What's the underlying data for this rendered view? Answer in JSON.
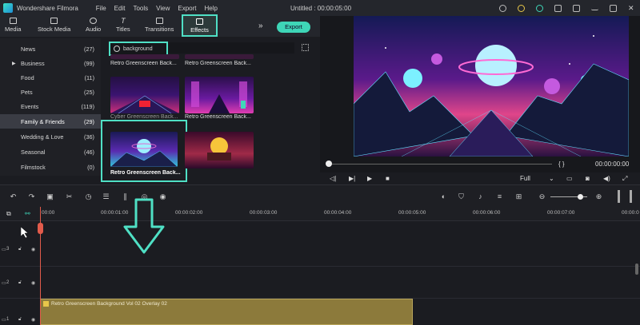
{
  "app": {
    "name": "Wondershare Filmora",
    "menu": [
      "File",
      "Edit",
      "Tools",
      "View",
      "Export",
      "Help"
    ],
    "window_title": "Untitled : 00:00:05:00"
  },
  "toolbar": {
    "tabs": [
      "Media",
      "Stock Media",
      "Audio",
      "Titles",
      "Transitions",
      "Effects"
    ],
    "export_label": "Export",
    "more": "»"
  },
  "categories": [
    {
      "name": "News",
      "count": "(27)"
    },
    {
      "name": "Business",
      "count": "(99)"
    },
    {
      "name": "Food",
      "count": "(11)"
    },
    {
      "name": "Pets",
      "count": "(25)"
    },
    {
      "name": "Events",
      "count": "(119)"
    },
    {
      "name": "Family & Friends",
      "count": "(29)"
    },
    {
      "name": "Wedding & Love",
      "count": "(36)"
    },
    {
      "name": "Seasonal",
      "count": "(46)"
    },
    {
      "name": "Filmstock",
      "count": "(0)"
    }
  ],
  "search": {
    "value": "background"
  },
  "effects": [
    {
      "caption": "Retro Greenscreen Back..."
    },
    {
      "caption": "Retro Greenscreen Back..."
    },
    {
      "caption": "Cyber Greenscreen Back..."
    },
    {
      "caption": "Retro Greenscreen Back..."
    },
    {
      "caption": "Retro Greenscreen Back..."
    }
  ],
  "player": {
    "timecode": "00:00:00:00",
    "quality": "Full",
    "brackets": "{ }"
  },
  "timeline": {
    "ticks": [
      "00:00",
      "00:00:01:00",
      "00:00:02:00",
      "00:00:03:00",
      "00:00:04:00",
      "00:00:05:00",
      "00:00:06:00",
      "00:00:07:00",
      "00:00:0"
    ],
    "tracks": [
      "3",
      "2",
      "1"
    ],
    "clip_label": "Retro Greenscreen Background Vol 02 Overlay 02"
  },
  "colors": {
    "accent": "#4fe0c5",
    "playhead": "#e25b4b",
    "clip": "#8c7a3b"
  }
}
